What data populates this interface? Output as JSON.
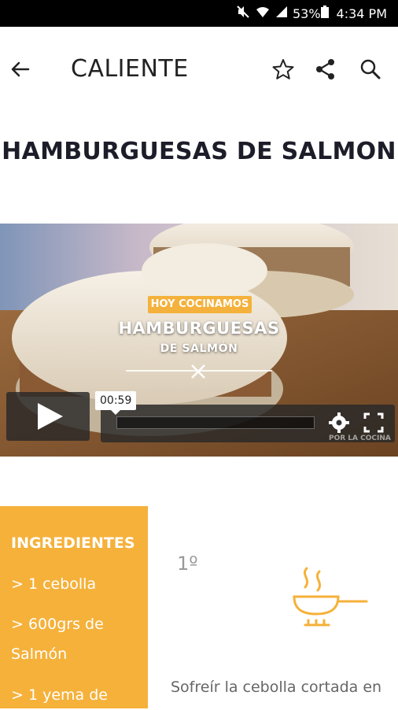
{
  "status_bar": {
    "battery": "53%",
    "time": "4:34 PM",
    "icons": [
      "mute-icon",
      "wifi-icon",
      "signal-icon",
      "battery-icon"
    ]
  },
  "app_bar": {
    "title": "CALIENTE",
    "icons": [
      "back-arrow-icon",
      "star-outline-icon",
      "share-icon",
      "search-icon"
    ]
  },
  "recipe": {
    "title": "HAMBURGUESAS DE SALMON"
  },
  "video": {
    "badge": "HOY COCINAMOS",
    "overlay_title": "HAMBURGUESAS",
    "overlay_subtitle": "DE SALMÓN",
    "time_tooltip": "00:59",
    "watermark": "POR LA COCINA"
  },
  "ingredients": {
    "title": "INGREDIENTES",
    "items": [
      "> 1 cebolla",
      "> 600grs de",
      "Salmón",
      "> 1 yema de"
    ]
  },
  "step": {
    "number": "1º",
    "icon": "frying-pan-icon",
    "text": "Sofreír la cebolla cortada en"
  },
  "colors": {
    "accent": "#f5b13a",
    "title_text": "#1d1d2a"
  }
}
